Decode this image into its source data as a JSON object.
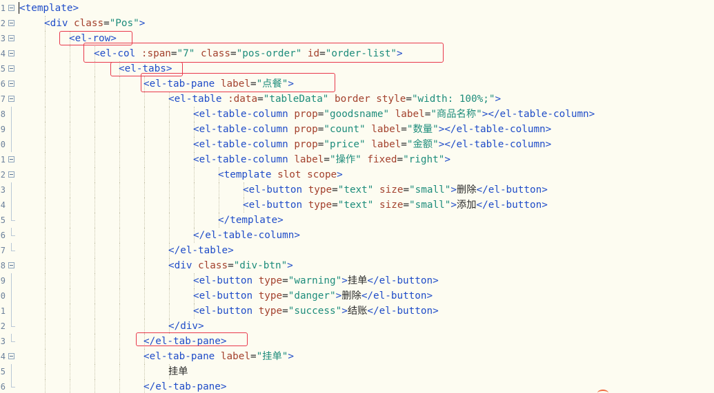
{
  "editor": {
    "lines": [
      {
        "num": "1",
        "fold": "open",
        "guides": 0,
        "code": "<template>",
        "parts": [
          {
            "c": "t",
            "s": "<template>"
          }
        ]
      },
      {
        "num": "2",
        "fold": "open",
        "guides": 1,
        "parts": [
          {
            "c": "t",
            "s": "<div "
          },
          {
            "c": "a",
            "s": "class"
          },
          {
            "c": "x",
            "s": "="
          },
          {
            "c": "v",
            "s": "\"Pos\""
          },
          {
            "c": "t",
            "s": ">"
          }
        ]
      },
      {
        "num": "3",
        "fold": "open",
        "guides": 2,
        "parts": [
          {
            "c": "t",
            "s": "<el-row>"
          }
        ]
      },
      {
        "num": "4",
        "fold": "open",
        "guides": 3,
        "parts": [
          {
            "c": "t",
            "s": "<el-col "
          },
          {
            "c": "a",
            "s": ":span"
          },
          {
            "c": "x",
            "s": "="
          },
          {
            "c": "v",
            "s": "\"7\""
          },
          {
            "c": "x",
            "s": " "
          },
          {
            "c": "a",
            "s": "class"
          },
          {
            "c": "x",
            "s": "="
          },
          {
            "c": "v",
            "s": "\"pos-order\""
          },
          {
            "c": "x",
            "s": " "
          },
          {
            "c": "a",
            "s": "id"
          },
          {
            "c": "x",
            "s": "="
          },
          {
            "c": "v",
            "s": "\"order-list\""
          },
          {
            "c": "t",
            "s": ">"
          }
        ]
      },
      {
        "num": "5",
        "fold": "open",
        "guides": 4,
        "parts": [
          {
            "c": "t",
            "s": "<el-tabs>"
          }
        ]
      },
      {
        "num": "6",
        "fold": "open",
        "guides": 5,
        "parts": [
          {
            "c": "t",
            "s": "<el-tab-pane "
          },
          {
            "c": "a",
            "s": "label"
          },
          {
            "c": "x",
            "s": "="
          },
          {
            "c": "v",
            "s": "\"点餐\""
          },
          {
            "c": "t",
            "s": ">"
          }
        ]
      },
      {
        "num": "7",
        "fold": "open",
        "guides": 6,
        "parts": [
          {
            "c": "t",
            "s": "<el-table "
          },
          {
            "c": "a",
            "s": ":data"
          },
          {
            "c": "x",
            "s": "="
          },
          {
            "c": "v",
            "s": "\"tableData\""
          },
          {
            "c": "x",
            "s": " "
          },
          {
            "c": "a",
            "s": "border"
          },
          {
            "c": "x",
            "s": " "
          },
          {
            "c": "a",
            "s": "style"
          },
          {
            "c": "x",
            "s": "="
          },
          {
            "c": "v",
            "s": "\"width: 100%;\""
          },
          {
            "c": "t",
            "s": ">"
          }
        ]
      },
      {
        "num": "8",
        "fold": "line",
        "guides": 7,
        "parts": [
          {
            "c": "t",
            "s": "<el-table-column "
          },
          {
            "c": "a",
            "s": "prop"
          },
          {
            "c": "x",
            "s": "="
          },
          {
            "c": "v",
            "s": "\"goodsname\""
          },
          {
            "c": "x",
            "s": " "
          },
          {
            "c": "a",
            "s": "label"
          },
          {
            "c": "x",
            "s": "="
          },
          {
            "c": "v",
            "s": "\"商品名称\""
          },
          {
            "c": "t",
            "s": "></el-table-column>"
          }
        ]
      },
      {
        "num": "9",
        "fold": "line",
        "guides": 7,
        "parts": [
          {
            "c": "t",
            "s": "<el-table-column "
          },
          {
            "c": "a",
            "s": "prop"
          },
          {
            "c": "x",
            "s": "="
          },
          {
            "c": "v",
            "s": "\"count\""
          },
          {
            "c": "x",
            "s": " "
          },
          {
            "c": "a",
            "s": "label"
          },
          {
            "c": "x",
            "s": "="
          },
          {
            "c": "v",
            "s": "\"数量\""
          },
          {
            "c": "t",
            "s": "></el-table-column>"
          }
        ]
      },
      {
        "num": "0",
        "fold": "line",
        "guides": 7,
        "parts": [
          {
            "c": "t",
            "s": "<el-table-column "
          },
          {
            "c": "a",
            "s": "prop"
          },
          {
            "c": "x",
            "s": "="
          },
          {
            "c": "v",
            "s": "\"price\""
          },
          {
            "c": "x",
            "s": " "
          },
          {
            "c": "a",
            "s": "label"
          },
          {
            "c": "x",
            "s": "="
          },
          {
            "c": "v",
            "s": "\"金额\""
          },
          {
            "c": "t",
            "s": "></el-table-column>"
          }
        ]
      },
      {
        "num": "1",
        "fold": "open",
        "guides": 7,
        "parts": [
          {
            "c": "t",
            "s": "<el-table-column "
          },
          {
            "c": "a",
            "s": "label"
          },
          {
            "c": "x",
            "s": "="
          },
          {
            "c": "v",
            "s": "\"操作\""
          },
          {
            "c": "x",
            "s": " "
          },
          {
            "c": "a",
            "s": "fixed"
          },
          {
            "c": "x",
            "s": "="
          },
          {
            "c": "v",
            "s": "\"right\""
          },
          {
            "c": "t",
            "s": ">"
          }
        ]
      },
      {
        "num": "2",
        "fold": "open",
        "guides": 8,
        "parts": [
          {
            "c": "t",
            "s": "<template "
          },
          {
            "c": "a",
            "s": "slot"
          },
          {
            "c": "x",
            "s": " "
          },
          {
            "c": "a",
            "s": "scope"
          },
          {
            "c": "t",
            "s": ">"
          }
        ]
      },
      {
        "num": "3",
        "fold": "line",
        "guides": 9,
        "parts": [
          {
            "c": "t",
            "s": "<el-button "
          },
          {
            "c": "a",
            "s": "type"
          },
          {
            "c": "x",
            "s": "="
          },
          {
            "c": "v",
            "s": "\"text\""
          },
          {
            "c": "x",
            "s": " "
          },
          {
            "c": "a",
            "s": "size"
          },
          {
            "c": "x",
            "s": "="
          },
          {
            "c": "v",
            "s": "\"small\""
          },
          {
            "c": "t",
            "s": ">"
          },
          {
            "c": "x",
            "s": "删除"
          },
          {
            "c": "t",
            "s": "</el-button>"
          }
        ]
      },
      {
        "num": "4",
        "fold": "line",
        "guides": 9,
        "parts": [
          {
            "c": "t",
            "s": "<el-button "
          },
          {
            "c": "a",
            "s": "type"
          },
          {
            "c": "x",
            "s": "="
          },
          {
            "c": "v",
            "s": "\"text\""
          },
          {
            "c": "x",
            "s": " "
          },
          {
            "c": "a",
            "s": "size"
          },
          {
            "c": "x",
            "s": "="
          },
          {
            "c": "v",
            "s": "\"small\""
          },
          {
            "c": "t",
            "s": ">"
          },
          {
            "c": "x",
            "s": "添加"
          },
          {
            "c": "t",
            "s": "</el-button>"
          }
        ]
      },
      {
        "num": "5",
        "fold": "end",
        "guides": 8,
        "parts": [
          {
            "c": "t",
            "s": "</template>"
          }
        ]
      },
      {
        "num": "6",
        "fold": "end",
        "guides": 7,
        "parts": [
          {
            "c": "t",
            "s": "</el-table-column>"
          }
        ]
      },
      {
        "num": "7",
        "fold": "end",
        "guides": 6,
        "parts": [
          {
            "c": "t",
            "s": "</el-table>"
          }
        ]
      },
      {
        "num": "8",
        "fold": "open",
        "guides": 6,
        "parts": [
          {
            "c": "t",
            "s": "<div "
          },
          {
            "c": "a",
            "s": "class"
          },
          {
            "c": "x",
            "s": "="
          },
          {
            "c": "v",
            "s": "\"div-btn\""
          },
          {
            "c": "t",
            "s": ">"
          }
        ]
      },
      {
        "num": "9",
        "fold": "line",
        "guides": 7,
        "parts": [
          {
            "c": "t",
            "s": "<el-button "
          },
          {
            "c": "a",
            "s": "type"
          },
          {
            "c": "x",
            "s": "="
          },
          {
            "c": "v",
            "s": "\"warning\""
          },
          {
            "c": "t",
            "s": ">"
          },
          {
            "c": "x",
            "s": "挂单"
          },
          {
            "c": "t",
            "s": "</el-button>"
          }
        ]
      },
      {
        "num": "0",
        "fold": "line",
        "guides": 7,
        "parts": [
          {
            "c": "t",
            "s": "<el-button "
          },
          {
            "c": "a",
            "s": "type"
          },
          {
            "c": "x",
            "s": "="
          },
          {
            "c": "v",
            "s": "\"danger\""
          },
          {
            "c": "t",
            "s": ">"
          },
          {
            "c": "x",
            "s": "删除"
          },
          {
            "c": "t",
            "s": "</el-button>"
          }
        ]
      },
      {
        "num": "1",
        "fold": "line",
        "guides": 7,
        "parts": [
          {
            "c": "t",
            "s": "<el-button "
          },
          {
            "c": "a",
            "s": "type"
          },
          {
            "c": "x",
            "s": "="
          },
          {
            "c": "v",
            "s": "\"success\""
          },
          {
            "c": "t",
            "s": ">"
          },
          {
            "c": "x",
            "s": "结账"
          },
          {
            "c": "t",
            "s": "</el-button>"
          }
        ]
      },
      {
        "num": "2",
        "fold": "end",
        "guides": 6,
        "parts": [
          {
            "c": "t",
            "s": "</div>"
          }
        ]
      },
      {
        "num": "3",
        "fold": "end",
        "guides": 5,
        "parts": [
          {
            "c": "t",
            "s": "</el-tab-pane>"
          }
        ]
      },
      {
        "num": "4",
        "fold": "open",
        "guides": 5,
        "parts": [
          {
            "c": "t",
            "s": "<el-tab-pane "
          },
          {
            "c": "a",
            "s": "label"
          },
          {
            "c": "x",
            "s": "="
          },
          {
            "c": "v",
            "s": "\"挂单\""
          },
          {
            "c": "t",
            "s": ">"
          }
        ]
      },
      {
        "num": "5",
        "fold": "line",
        "guides": 6,
        "parts": [
          {
            "c": "x",
            "s": "挂单"
          }
        ]
      },
      {
        "num": "6",
        "fold": "end",
        "guides": 5,
        "parts": [
          {
            "c": "t",
            "s": "</el-tab-pane>"
          }
        ]
      }
    ]
  }
}
